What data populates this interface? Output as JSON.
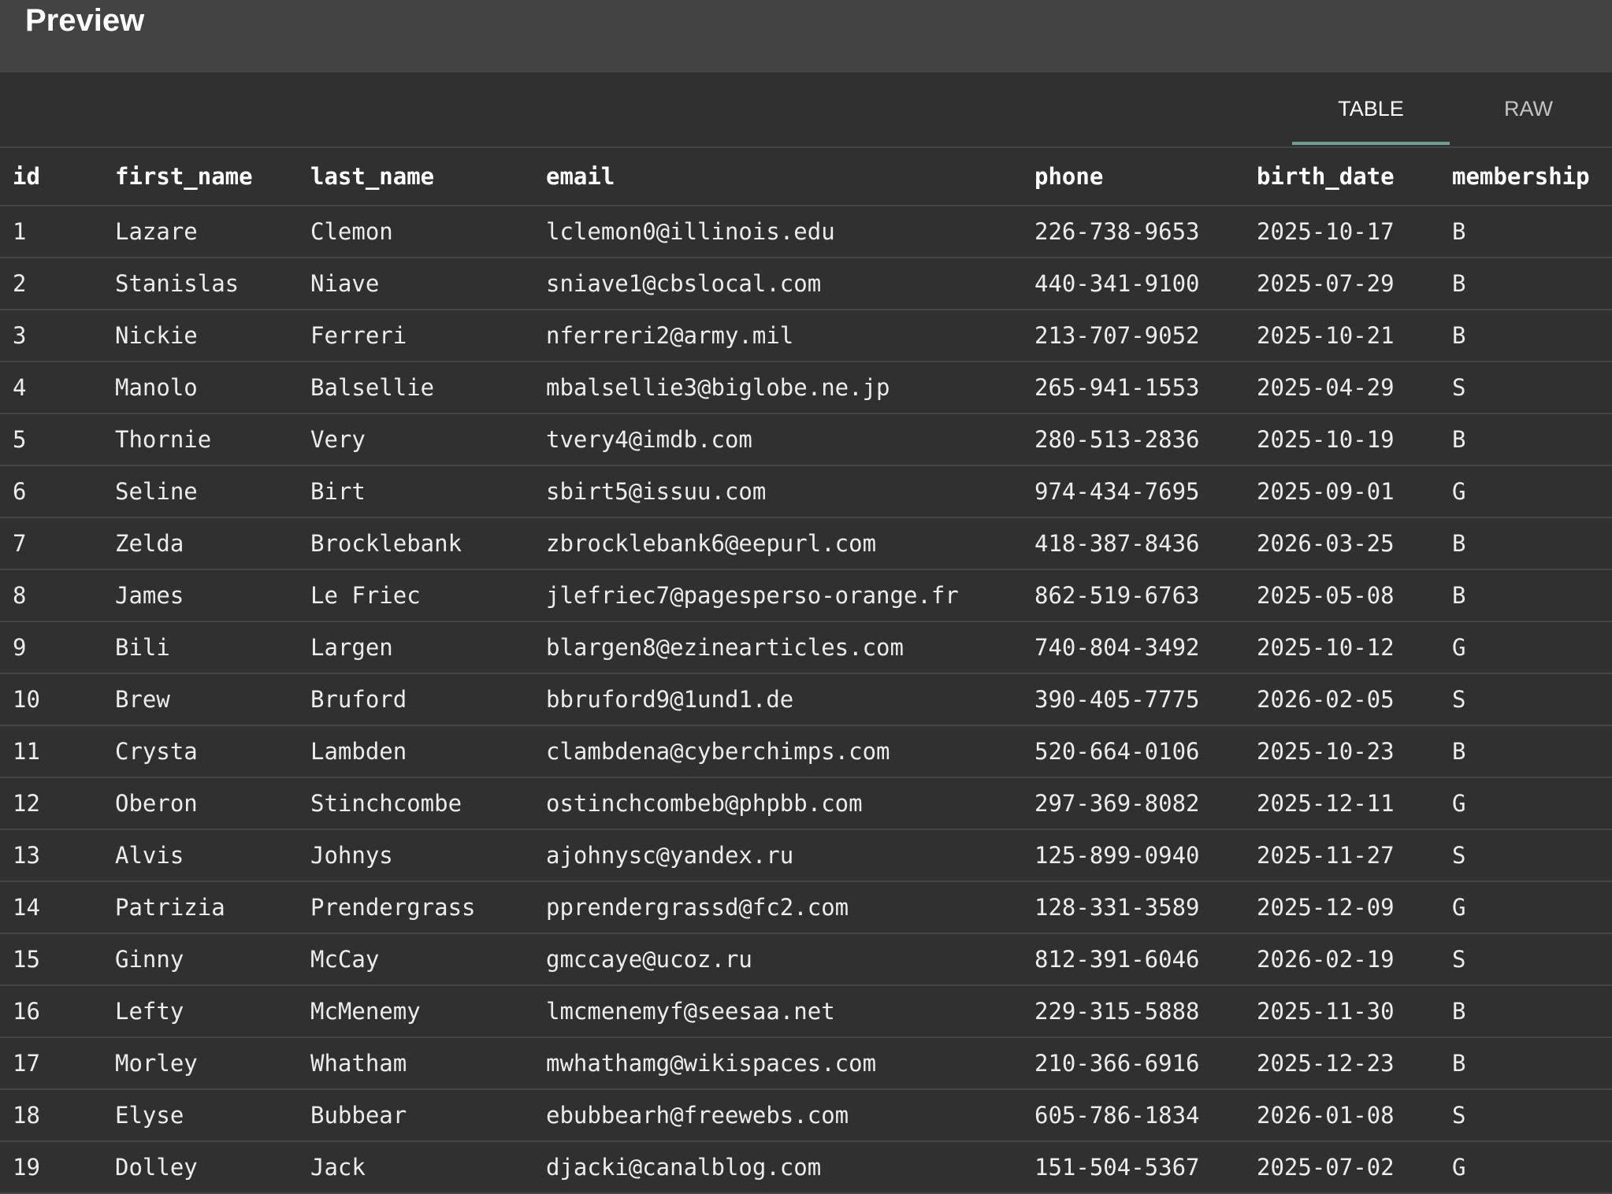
{
  "header": {
    "title": "Preview"
  },
  "tabs": [
    {
      "label": "TABLE",
      "active": true
    },
    {
      "label": "RAW",
      "active": false
    }
  ],
  "table": {
    "columns": [
      "id",
      "first_name",
      "last_name",
      "email",
      "phone",
      "birth_date",
      "membership"
    ],
    "rows": [
      [
        "1",
        "Lazare",
        "Clemon",
        "lclemon0@illinois.edu",
        "226-738-9653",
        "2025-10-17",
        "B"
      ],
      [
        "2",
        "Stanislas",
        "Niave",
        "sniave1@cbslocal.com",
        "440-341-9100",
        "2025-07-29",
        "B"
      ],
      [
        "3",
        "Nickie",
        "Ferreri",
        "nferreri2@army.mil",
        "213-707-9052",
        "2025-10-21",
        "B"
      ],
      [
        "4",
        "Manolo",
        "Balsellie",
        "mbalsellie3@biglobe.ne.jp",
        "265-941-1553",
        "2025-04-29",
        "S"
      ],
      [
        "5",
        "Thornie",
        "Very",
        "tvery4@imdb.com",
        "280-513-2836",
        "2025-10-19",
        "B"
      ],
      [
        "6",
        "Seline",
        "Birt",
        "sbirt5@issuu.com",
        "974-434-7695",
        "2025-09-01",
        "G"
      ],
      [
        "7",
        "Zelda",
        "Brocklebank",
        "zbrocklebank6@eepurl.com",
        "418-387-8436",
        "2026-03-25",
        "B"
      ],
      [
        "8",
        "James",
        "Le Friec",
        "jlefriec7@pagesperso-orange.fr",
        "862-519-6763",
        "2025-05-08",
        "B"
      ],
      [
        "9",
        "Bili",
        "Largen",
        "blargen8@ezinearticles.com",
        "740-804-3492",
        "2025-10-12",
        "G"
      ],
      [
        "10",
        "Brew",
        "Bruford",
        "bbruford9@1und1.de",
        "390-405-7775",
        "2026-02-05",
        "S"
      ],
      [
        "11",
        "Crysta",
        "Lambden",
        "clambdena@cyberchimps.com",
        "520-664-0106",
        "2025-10-23",
        "B"
      ],
      [
        "12",
        "Oberon",
        "Stinchcombe",
        "ostinchcombeb@phpbb.com",
        "297-369-8082",
        "2025-12-11",
        "G"
      ],
      [
        "13",
        "Alvis",
        "Johnys",
        "ajohnysc@yandex.ru",
        "125-899-0940",
        "2025-11-27",
        "S"
      ],
      [
        "14",
        "Patrizia",
        "Prendergrass",
        "pprendergrassd@fc2.com",
        "128-331-3589",
        "2025-12-09",
        "G"
      ],
      [
        "15",
        "Ginny",
        "McCay",
        "gmccaye@ucoz.ru",
        "812-391-6046",
        "2026-02-19",
        "S"
      ],
      [
        "16",
        "Lefty",
        "McMenemy",
        "lmcmenemyf@seesaa.net",
        "229-315-5888",
        "2025-11-30",
        "B"
      ],
      [
        "17",
        "Morley",
        "Whatham",
        "mwhathamg@wikispaces.com",
        "210-366-6916",
        "2025-12-23",
        "B"
      ],
      [
        "18",
        "Elyse",
        "Bubbear",
        "ebubbearh@freewebs.com",
        "605-786-1834",
        "2026-01-08",
        "S"
      ],
      [
        "19",
        "Dolley",
        "Jack",
        "djacki@canalblog.com",
        "151-504-5367",
        "2025-07-02",
        "G"
      ]
    ]
  }
}
